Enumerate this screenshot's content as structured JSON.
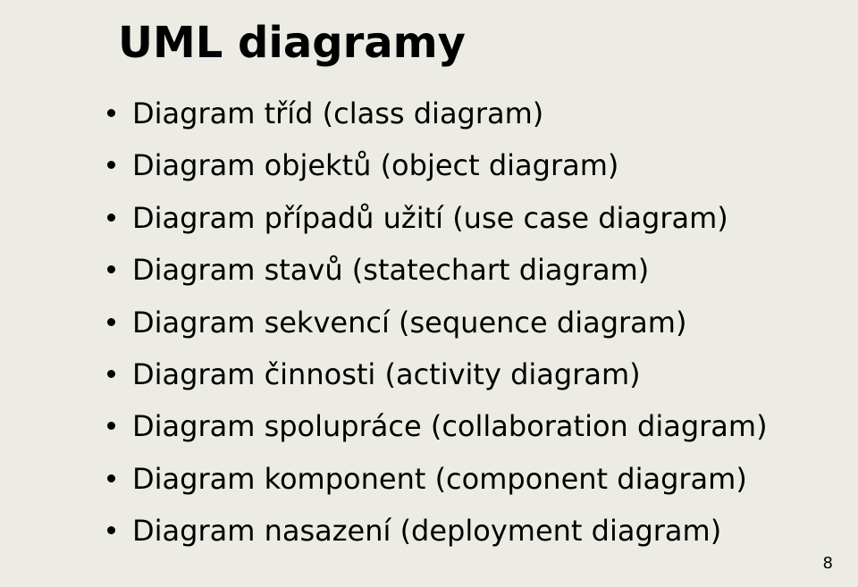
{
  "slide": {
    "title": "UML diagramy",
    "bullets": [
      "Diagram tříd (class diagram)",
      "Diagram objektů (object diagram)",
      "Diagram případů užití (use case diagram)",
      "Diagram stavů (statechart diagram)",
      "Diagram sekvencí (sequence diagram)",
      "Diagram činnosti (activity diagram)",
      "Diagram spolupráce (collaboration diagram)",
      "Diagram komponent (component diagram)",
      "Diagram nasazení (deployment diagram)"
    ],
    "page_number": "8"
  }
}
